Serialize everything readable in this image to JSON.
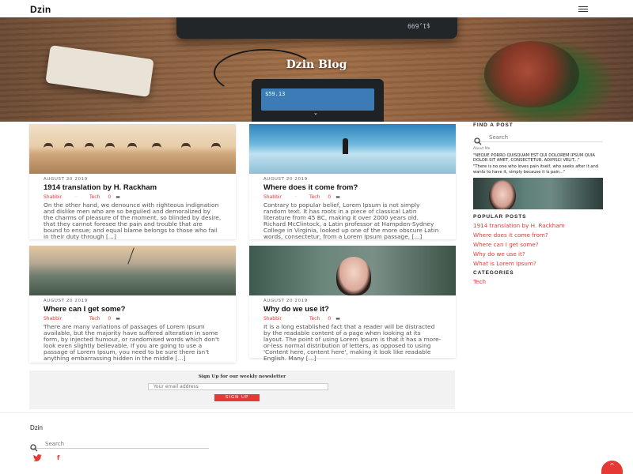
{
  "site": {
    "brand": "Dzin"
  },
  "hero": {
    "title": "Dzin Blog"
  },
  "posts": [
    {
      "date": "AUGUST 20 2019",
      "title": "1914 translation by H. Rackham",
      "author": "Shabbir",
      "category": "Tech",
      "comments": "0",
      "excerpt": "On the other hand, we denounce with righteous indignation and dislike men who are so beguiled and demoralized by the charms of pleasure of the moment, so blinded by desire, that they cannot foresee the pain and trouble that are bound to ensue; and equal blame belongs to those who fail in their duty through [...]"
    },
    {
      "date": "AUGUST 20 2019",
      "title": "Where does it come from?",
      "author": "Shabbir",
      "category": "Tech",
      "comments": "0",
      "excerpt": "Contrary to popular belief, Lorem Ipsum is not simply random text. It has roots in a piece of classical Latin literature from 45 BC, making it over 2000 years old. Richard McClintock, a Latin professor at Hampden-Sydney College in Virginia, looked up one of the more obscure Latin words, consectetur, from a Lorem Ipsum passage, [...]"
    },
    {
      "date": "AUGUST 20 2019",
      "title": "Where can I get some?",
      "author": "Shabbir",
      "category": "Tech",
      "comments": "0",
      "excerpt": "There are many variations of passages of Lorem Ipsum available, but the majority have suffered alteration in some form, by injected humour, or randomised words which don't look even slightly believable. If you are going to use a passage of Lorem Ipsum, you need to be sure there isn't anything embarrassing hidden in the middle [...]"
    },
    {
      "date": "AUGUST 20 2019",
      "title": "Why do we use it?",
      "author": "Shabbir",
      "category": "Tech",
      "comments": "0",
      "excerpt": "It is a long established fact that a reader will be distracted by the readable content of a page when looking at its layout. The point of using Lorem Ipsum is that it has a more-or-less normal distribution of letters, as opposed to using 'Content here, content here', making it look like readable English. Many [...]"
    }
  ],
  "newsletter": {
    "title": "Sign Up for our weekly newsletter",
    "placeholder": "Your email address",
    "button": "SIGN UP"
  },
  "sidebar": {
    "find_heading": "FIND A POST",
    "search_placeholder": "Search",
    "about_label": "About Me",
    "quote": "\"NEQUE PORRO QUISQUAM EST QUI DOLOREM IPSUM QUIA DOLOR SIT AMET, CONSECTETUR, ADIPISCI VELIT...\"",
    "quote_translation": "\"There is no one who loves pain itself, who seeks after it and wants to have it, simply because it is pain...\"",
    "popular_heading": "POPULAR POSTS",
    "popular": [
      "1914 translation by H. Rackham",
      "Where does it come from?",
      "Where can I get some?",
      "Why do we use it?",
      "What is Lorem Ipsum?"
    ],
    "categories_heading": "CATEGORIES",
    "categories": [
      "Tech"
    ]
  },
  "footer": {
    "brand": "Dzin",
    "search_placeholder": "Search",
    "social": [
      {
        "icon": "twitter-icon",
        "glyph": "🐦"
      },
      {
        "icon": "facebook-icon",
        "glyph": "f"
      }
    ]
  },
  "colors": {
    "accent": "#e53935"
  }
}
